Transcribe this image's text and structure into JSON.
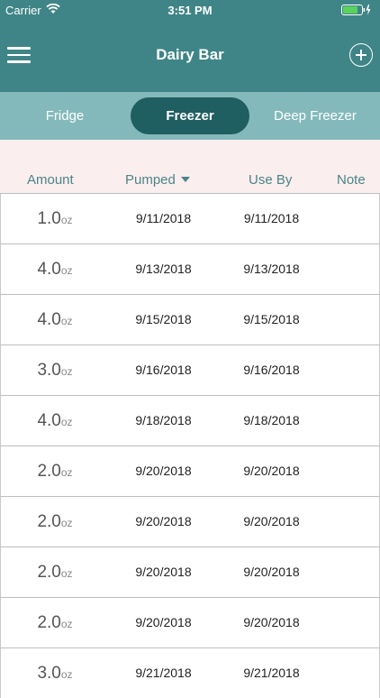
{
  "status": {
    "carrier": "Carrier",
    "time": "3:51 PM"
  },
  "nav": {
    "title": "Dairy Bar"
  },
  "tabs": {
    "fridge": "Fridge",
    "freezer": "Freezer",
    "deep_freezer": "Deep Freezer",
    "selected": "Freezer"
  },
  "columns": {
    "amount": "Amount",
    "pumped": "Pumped",
    "use_by": "Use By",
    "note": "Note"
  },
  "unit": "oz",
  "rows": [
    {
      "amount": "1.0",
      "pumped": "9/11/2018",
      "use_by": "9/11/2018"
    },
    {
      "amount": "4.0",
      "pumped": "9/13/2018",
      "use_by": "9/13/2018"
    },
    {
      "amount": "4.0",
      "pumped": "9/15/2018",
      "use_by": "9/15/2018"
    },
    {
      "amount": "3.0",
      "pumped": "9/16/2018",
      "use_by": "9/16/2018"
    },
    {
      "amount": "4.0",
      "pumped": "9/18/2018",
      "use_by": "9/18/2018"
    },
    {
      "amount": "2.0",
      "pumped": "9/20/2018",
      "use_by": "9/20/2018"
    },
    {
      "amount": "2.0",
      "pumped": "9/20/2018",
      "use_by": "9/20/2018"
    },
    {
      "amount": "2.0",
      "pumped": "9/20/2018",
      "use_by": "9/20/2018"
    },
    {
      "amount": "2.0",
      "pumped": "9/20/2018",
      "use_by": "9/20/2018"
    },
    {
      "amount": "3.0",
      "pumped": "9/21/2018",
      "use_by": "9/21/2018"
    }
  ]
}
